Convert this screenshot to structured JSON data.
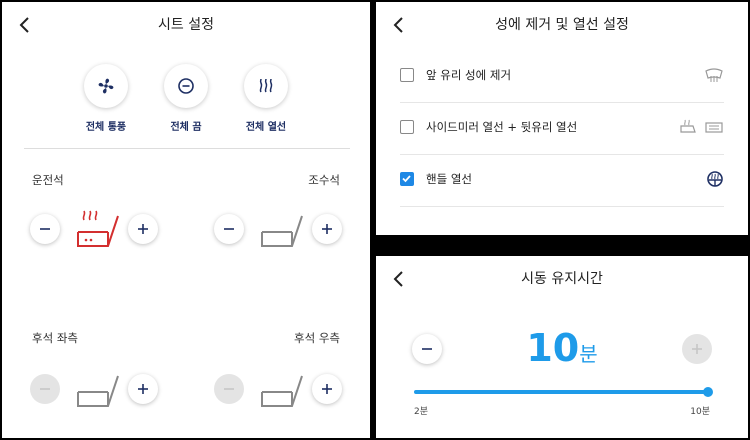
{
  "seat": {
    "title": "시트 설정",
    "quick_buttons": [
      {
        "label": "전체 통풍",
        "icon": "fan-icon"
      },
      {
        "label": "전체 끔",
        "icon": "power-off-icon"
      },
      {
        "label": "전체 열선",
        "icon": "heat-icon"
      }
    ],
    "driver_label": "운전석",
    "passenger_label": "조수석",
    "rear_left_label": "후석 좌측",
    "rear_right_label": "후석 우측",
    "accent_color": "#d32f2f",
    "brand_color": "#1e2f63"
  },
  "defrost": {
    "title": "성에 제거 및 열선 설정",
    "options": [
      {
        "label": "앞 유리 성에 제거",
        "checked": false,
        "icons": [
          "front-defrost-icon"
        ]
      },
      {
        "label": "사이드미러 열선 + 뒷유리 열선",
        "checked": false,
        "icons": [
          "mirror-heat-icon",
          "rear-defrost-icon"
        ]
      },
      {
        "label": "핸들 열선",
        "checked": true,
        "icons": [
          "steering-heat-icon"
        ]
      }
    ],
    "checkbox_color": "#1e88e5"
  },
  "idle": {
    "title": "시동 유지시간",
    "value": "10",
    "unit": "분",
    "min_label": "2분",
    "max_label": "10분",
    "slider_fraction": 1.0,
    "accent_color": "#1e9be9"
  }
}
